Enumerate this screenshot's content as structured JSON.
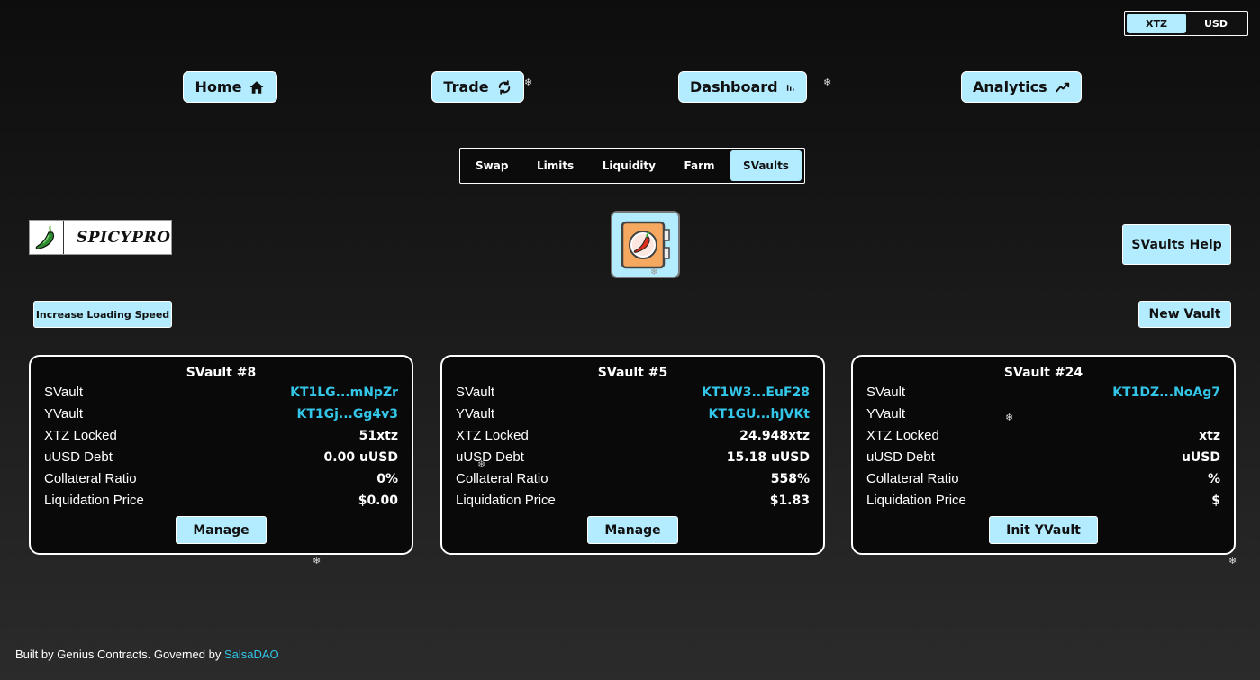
{
  "currency": {
    "options": [
      "XTZ",
      "USD"
    ],
    "selected": "XTZ"
  },
  "nav": {
    "home": "Home",
    "trade": "Trade",
    "dashboard": "Dashboard",
    "analytics": "Analytics"
  },
  "subtabs": [
    "Swap",
    "Limits",
    "Liquidity",
    "Farm",
    "SVaults"
  ],
  "subtab_active": "SVaults",
  "logo": {
    "text": "SPICYPRO"
  },
  "buttons": {
    "help": "SVaults Help",
    "speed": "Increase Loading Speed",
    "new_vault": "New Vault"
  },
  "cards": [
    {
      "title": "SVault #8",
      "rows": [
        {
          "label": "SVault",
          "value": "KT1LG...mNpZr"
        },
        {
          "label": "YVault",
          "value": "KT1Gj...Gg4v3"
        },
        {
          "label": "XTZ Locked",
          "value": "51xtz"
        },
        {
          "label": "uUSD Debt",
          "value": "0.00 uUSD"
        },
        {
          "label": "Collateral Ratio",
          "value": "0%"
        },
        {
          "label": "Liquidation Price",
          "value": "$0.00"
        }
      ],
      "action": "Manage"
    },
    {
      "title": "SVault #5",
      "rows": [
        {
          "label": "SVault",
          "value": "KT1W3...EuF28"
        },
        {
          "label": "YVault",
          "value": "KT1GU...hJVKt"
        },
        {
          "label": "XTZ Locked",
          "value": "24.948xtz"
        },
        {
          "label": "uUSD Debt",
          "value": "15.18 uUSD"
        },
        {
          "label": "Collateral Ratio",
          "value": "558%"
        },
        {
          "label": "Liquidation Price",
          "value": "$1.83"
        }
      ],
      "action": "Manage"
    },
    {
      "title": "SVault #24",
      "rows": [
        {
          "label": "SVault",
          "value": "KT1DZ...NoAg7"
        },
        {
          "label": "YVault",
          "value": ""
        },
        {
          "label": "XTZ Locked",
          "value": "xtz"
        },
        {
          "label": "uUSD Debt",
          "value": "uUSD"
        },
        {
          "label": "Collateral Ratio",
          "value": "%"
        },
        {
          "label": "Liquidation Price",
          "value": "$"
        }
      ],
      "action": "Init YVault"
    }
  ],
  "footer": {
    "text": "Built by Genius Contracts. Governed by ",
    "link": "SalsaDAO"
  },
  "colors": {
    "accent": "#b3ecff",
    "link": "#33c6e8"
  },
  "icons": [
    "home-icon",
    "sync-icon",
    "bar-chart-icon",
    "trend-line-icon",
    "pepper-icon",
    "vault-icon",
    "snowflake-icon"
  ]
}
